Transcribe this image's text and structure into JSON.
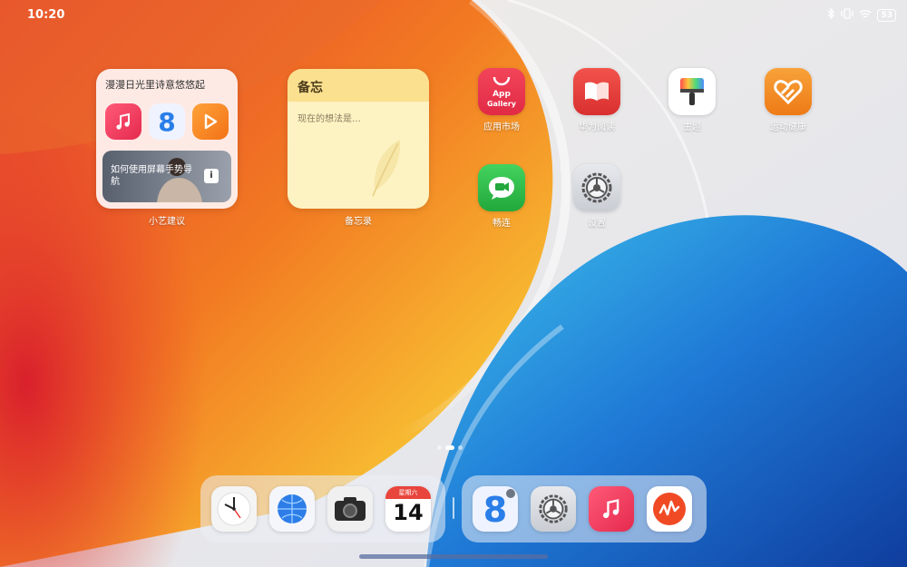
{
  "status_bar": {
    "time": "10:20",
    "battery": "53",
    "icons": [
      "bluetooth-icon",
      "vibrate-icon",
      "wifi-icon",
      "battery-icon"
    ]
  },
  "widgets": {
    "xiaoyi": {
      "title": "漫漫日光里诗意悠悠起",
      "card_text": "如何使用屏幕手势导航",
      "label": "小艺建议",
      "apps": [
        "music-icon",
        "eight-icon",
        "video-icon"
      ]
    },
    "memo": {
      "title": "备忘",
      "placeholder": "现在的想法是…",
      "label": "备忘录"
    }
  },
  "apps": [
    {
      "name": "app-gallery",
      "label": "应用市场",
      "icon_text": "App\nGallery",
      "color": "#e8314a"
    },
    {
      "name": "huawei-read",
      "label": "华为阅读",
      "color": "#e23b3b"
    },
    {
      "name": "theme",
      "label": "主题",
      "color": "#ffffff"
    },
    {
      "name": "health",
      "label": "运动健康",
      "color": "#f28b1e"
    },
    {
      "name": "meetime",
      "label": "畅连",
      "color": "#2eb84b"
    },
    {
      "name": "settings",
      "label": "设置",
      "color": "#d9dce1"
    }
  ],
  "dock": {
    "left": [
      "clock-icon",
      "browser-icon",
      "camera-icon",
      "calendar-icon"
    ],
    "right": [
      "eight-icon",
      "settings-icon",
      "music-icon",
      "mic-icon"
    ],
    "calendar": {
      "weekday": "星期六",
      "day": "14"
    }
  },
  "page_dots": {
    "count": 3,
    "active": 1
  }
}
